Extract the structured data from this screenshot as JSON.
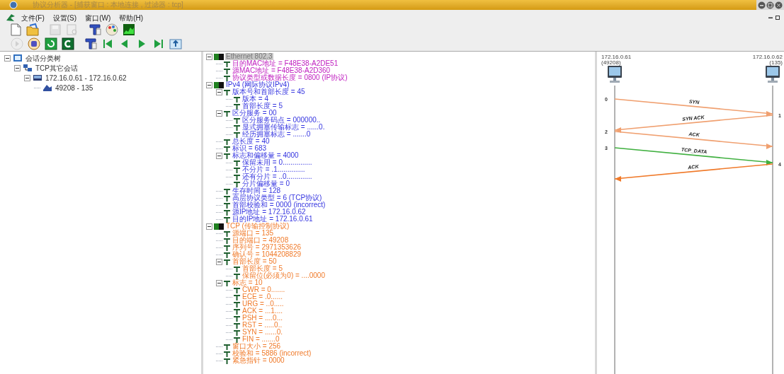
{
  "window": {
    "title": "协议分析器 - [捕获窗口 : 本地连接 , 过滤器 : tcp]"
  },
  "menu": [
    {
      "label": "文件(F)"
    },
    {
      "label": "设置(S)"
    },
    {
      "label": "窗口(W)"
    },
    {
      "label": "帮助(H)"
    }
  ],
  "toolbar_1": [
    {
      "kind": "new",
      "disabled": false
    },
    {
      "kind": "open",
      "disabled": false
    },
    {
      "kind": "save",
      "disabled": true
    },
    {
      "kind": "preview",
      "disabled": true
    },
    {
      "kind": "filter",
      "disabled": false
    },
    {
      "kind": "palette",
      "disabled": false
    },
    {
      "kind": "chart",
      "disabled": false
    }
  ],
  "toolbar_2": [
    {
      "kind": "play",
      "disabled": true
    },
    {
      "kind": "stop",
      "disabled": false
    },
    {
      "kind": "refresh",
      "disabled": false
    },
    {
      "kind": "clear",
      "disabled": false
    },
    {
      "kind": "filter",
      "disabled": false
    },
    {
      "kind": "first",
      "disabled": false
    },
    {
      "kind": "prev",
      "disabled": false
    },
    {
      "kind": "next",
      "disabled": false
    },
    {
      "kind": "last",
      "disabled": false
    },
    {
      "kind": "export",
      "disabled": false
    }
  ],
  "session_tree": [
    {
      "text": "会话分类树",
      "kind": "root",
      "expanded": true,
      "selected": false,
      "children": [
        {
          "text": "TCP其它会话",
          "kind": "group",
          "expanded": true,
          "selected": false,
          "children": [
            {
              "text": "172.16.0.61 - 172.16.0.62",
              "kind": "hosts",
              "expanded": true,
              "selected": false,
              "children": [
                {
                  "text": "49208 - 135",
                  "kind": "session",
                  "selected": false
                }
              ]
            }
          ]
        }
      ]
    }
  ],
  "packet_tree": [
    {
      "text": "Ethernet 802.3",
      "kind": "layer",
      "color": "#c020c0",
      "expanded": true,
      "selected": true,
      "children": [
        {
          "text": "目的MAC地址 = F48E38-A2DE51",
          "kind": "field",
          "selected": false
        },
        {
          "text": "源MAC地址 = F48E38-A2D360",
          "kind": "field",
          "selected": false
        },
        {
          "text": "协议类型或数据长度 = 0800 (IP协议)",
          "kind": "field",
          "selected": false
        }
      ]
    },
    {
      "text": "IPv4 (网际协议IPv4)",
      "kind": "layer",
      "color": "#3535e0",
      "expanded": true,
      "selected": false,
      "children": [
        {
          "text": "版本号和首部长度 = 45",
          "kind": "field",
          "expanded": true,
          "selected": false,
          "children": [
            {
              "text": "版本 = 4",
              "kind": "field",
              "selected": false
            },
            {
              "text": "首部长度 = 5",
              "kind": "field",
              "selected": false
            }
          ]
        },
        {
          "text": "区分服务 = 00",
          "kind": "field",
          "expanded": true,
          "selected": false,
          "children": [
            {
              "text": "区分服务码点 = 000000..",
              "kind": "field",
              "selected": false
            },
            {
              "text": "显式拥塞传输标志 = ......0.",
              "kind": "field",
              "selected": false
            },
            {
              "text": "经历拥塞标志 = .......0",
              "kind": "field",
              "selected": false
            }
          ]
        },
        {
          "text": "总长度 = 40",
          "kind": "field",
          "selected": false
        },
        {
          "text": "标识 = 683",
          "kind": "field",
          "selected": false
        },
        {
          "text": "标志和偏移量 = 4000",
          "kind": "field",
          "expanded": true,
          "selected": false,
          "children": [
            {
              "text": "保留未用 = 0...............",
              "kind": "field",
              "selected": false
            },
            {
              "text": "不分片 = .1..............",
              "kind": "field",
              "selected": false
            },
            {
              "text": "还有分片 = ..0.............",
              "kind": "field",
              "selected": false
            },
            {
              "text": "分片偏移量 = 0",
              "kind": "field",
              "selected": false
            }
          ]
        },
        {
          "text": "生存时间 = 128",
          "kind": "field",
          "selected": false
        },
        {
          "text": "高层协议类型 = 6 (TCP协议)",
          "kind": "field",
          "selected": false
        },
        {
          "text": "首部校验和 = 0000 (incorrect)",
          "kind": "field",
          "selected": false
        },
        {
          "text": "源IP地址 = 172.16.0.62",
          "kind": "field",
          "selected": false
        },
        {
          "text": "目的IP地址 = 172.16.0.61",
          "kind": "field",
          "selected": false
        }
      ]
    },
    {
      "text": "TCP (传输控制协议)",
      "kind": "layer",
      "color": "#f07a2a",
      "expanded": true,
      "selected": false,
      "children": [
        {
          "text": "源端口 = 135",
          "kind": "field",
          "selected": false
        },
        {
          "text": "目的端口 = 49208",
          "kind": "field",
          "selected": false
        },
        {
          "text": "序列号 = 2971353626",
          "kind": "field",
          "selected": false
        },
        {
          "text": "确认号 = 1044208829",
          "kind": "field",
          "selected": false
        },
        {
          "text": "首部长度 = 50",
          "kind": "field",
          "expanded": true,
          "selected": false,
          "children": [
            {
              "text": "首部长度 = 5",
              "kind": "field",
              "selected": false
            },
            {
              "text": "保留位(必须为0) = ....0000",
              "kind": "field",
              "selected": false
            }
          ]
        },
        {
          "text": "标志 = 10",
          "kind": "field",
          "expanded": true,
          "selected": false,
          "children": [
            {
              "text": "CWR = 0.......",
              "kind": "field",
              "selected": false
            },
            {
              "text": "ECE = .0......",
              "kind": "field",
              "selected": false
            },
            {
              "text": "URG = ..0.....",
              "kind": "field",
              "selected": false
            },
            {
              "text": "ACK = ...1....",
              "kind": "field",
              "selected": false
            },
            {
              "text": "PSH = ....0...",
              "kind": "field",
              "selected": false
            },
            {
              "text": "RST = .....0..",
              "kind": "field",
              "selected": false
            },
            {
              "text": "SYN = ......0.",
              "kind": "field",
              "selected": false
            },
            {
              "text": "FIN = .......0",
              "kind": "field",
              "selected": false
            }
          ]
        },
        {
          "text": "窗口大小 = 256",
          "kind": "field",
          "selected": false
        },
        {
          "text": "校验和 = 5886 (incorrect)",
          "kind": "field",
          "selected": false
        },
        {
          "text": "紧急指针 = 0000",
          "kind": "field",
          "selected": false
        }
      ]
    }
  ],
  "sequence": {
    "hosts": [
      {
        "address": "172.16.0.61",
        "port": "(49208)"
      },
      {
        "address": "172.16.0.62",
        "port": "(135)"
      }
    ],
    "messages": [
      {
        "label": "SYN",
        "kind": "outbound",
        "color": "#f0a070"
      },
      {
        "label": "SYN ACK",
        "kind": "inbound",
        "color": "#f0a070"
      },
      {
        "label": "ACK",
        "kind": "outbound",
        "color": "#f0a070"
      },
      {
        "label": "TCP_DATA",
        "kind": "outbound",
        "color": "#40b040"
      },
      {
        "label": "ACK",
        "kind": "inbound",
        "color": "#f07a2a"
      }
    ],
    "packet_numbers": [
      {
        "text": "0",
        "kind": "client"
      },
      {
        "text": "1",
        "kind": "server"
      },
      {
        "text": "2",
        "kind": "client"
      },
      {
        "text": "3",
        "kind": "client"
      },
      {
        "text": "4",
        "kind": "server"
      }
    ]
  }
}
